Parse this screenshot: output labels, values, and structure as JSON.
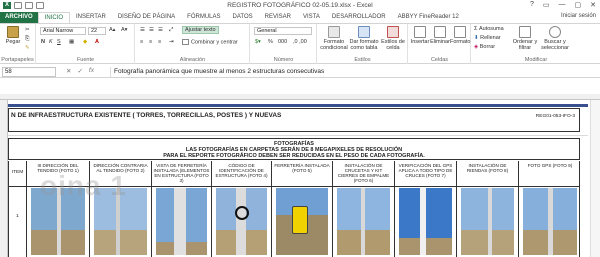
{
  "window": {
    "title": "REGISTRO FOTOGRÁFICO 02-05.19.xlsx - Excel",
    "app_logo": "X",
    "controls": [
      "?",
      "▭",
      "—",
      "▢",
      "✕"
    ],
    "signin": "Iniciar sesión"
  },
  "tabs": [
    "ARCHIVO",
    "INICIO",
    "INSERTAR",
    "DISEÑO DE PÁGINA",
    "FÓRMULAS",
    "DATOS",
    "REVISAR",
    "VISTA",
    "DESARROLLADOR",
    "ABBYY FineReader 12"
  ],
  "ribbon": {
    "clipboard": {
      "paste": "Pegar",
      "label": "Portapapeles"
    },
    "font": {
      "name": "Arial Narrow",
      "size": "22",
      "label": "Fuente"
    },
    "alignment": {
      "wrap": "Ajustar texto",
      "merge": "Combinar y centrar",
      "label": "Alineación"
    },
    "number": {
      "format": "General",
      "label": "Número"
    },
    "styles": {
      "conditional": "Formato condicional",
      "as_table": "Dar formato como tabla",
      "cell_styles": "Estilos de celda",
      "label": "Estilos"
    },
    "cells": {
      "insert": "Insertar",
      "delete": "Eliminar",
      "format": "Formato",
      "label": "Celdas"
    },
    "editing": {
      "autosum": "Autosuma",
      "fill": "Rellenar",
      "clear": "Borrar",
      "sort": "Ordenar y filtrar",
      "find": "Buscar y seleccionar",
      "label": "Modificar"
    }
  },
  "formula_bar": {
    "name_box": "58",
    "fx": "fx",
    "content": "Fotografía panorámica que muestre al menos 2 estructuras consecutivas"
  },
  "sheet": {
    "title": "N DE INFRAESTRUCTURA EXISTENTE ( TORRES, TORRECILLAS, POSTES ) Y NUEVAS",
    "code": "REG01-053-IFO-3",
    "foto_heading": "FOTOGRAFÍAS",
    "foto_line1": "LAS FOTOGRAFÍAS EN CARPETAS SERÁN DE 8 MEGAPIXELES DE RESOLUCIÓN",
    "foto_line2": "PARA EL REPORTE FOTOGRÁFICO DEBEN SER REDUCIDAS EN EL PESO DE CADA FOTOGRAFÍA.",
    "item_label": "ITEM",
    "item_number": "1",
    "watermark": "oina 1",
    "columns": [
      "III DIRECCIÓN DEL TENDIDO (FOTO 1)",
      "DIRECCIÓN CONTRARIA AL TENDIDO (FOTO 2)",
      "VISTA DE FERRETERÍA INSTALADA (ELEMENTOS EN ESTRUCTURA (FOTO 3)",
      "CÓDIGO DE IDENTIFICACIÓN DE ESTRUCTURA (FOTO 4)",
      "FERRETERÍA INSTALADA (FOTO 5)",
      "INSTALACIÓN DE CRUCETAS Y KIT CIERRES DE EMPALME (FOTO 6)",
      "VERIFICACIÓN DEL GPS APLICA A TODO TIPO DE CRUCES (FOTO 7)",
      "INSTALACIÓN DE RIENDAS (FOTO 8)",
      "FOTO GPS (FOTO 9)"
    ]
  },
  "colors": {
    "excel_green": "#217346",
    "header_band": "#3a4f8e"
  }
}
